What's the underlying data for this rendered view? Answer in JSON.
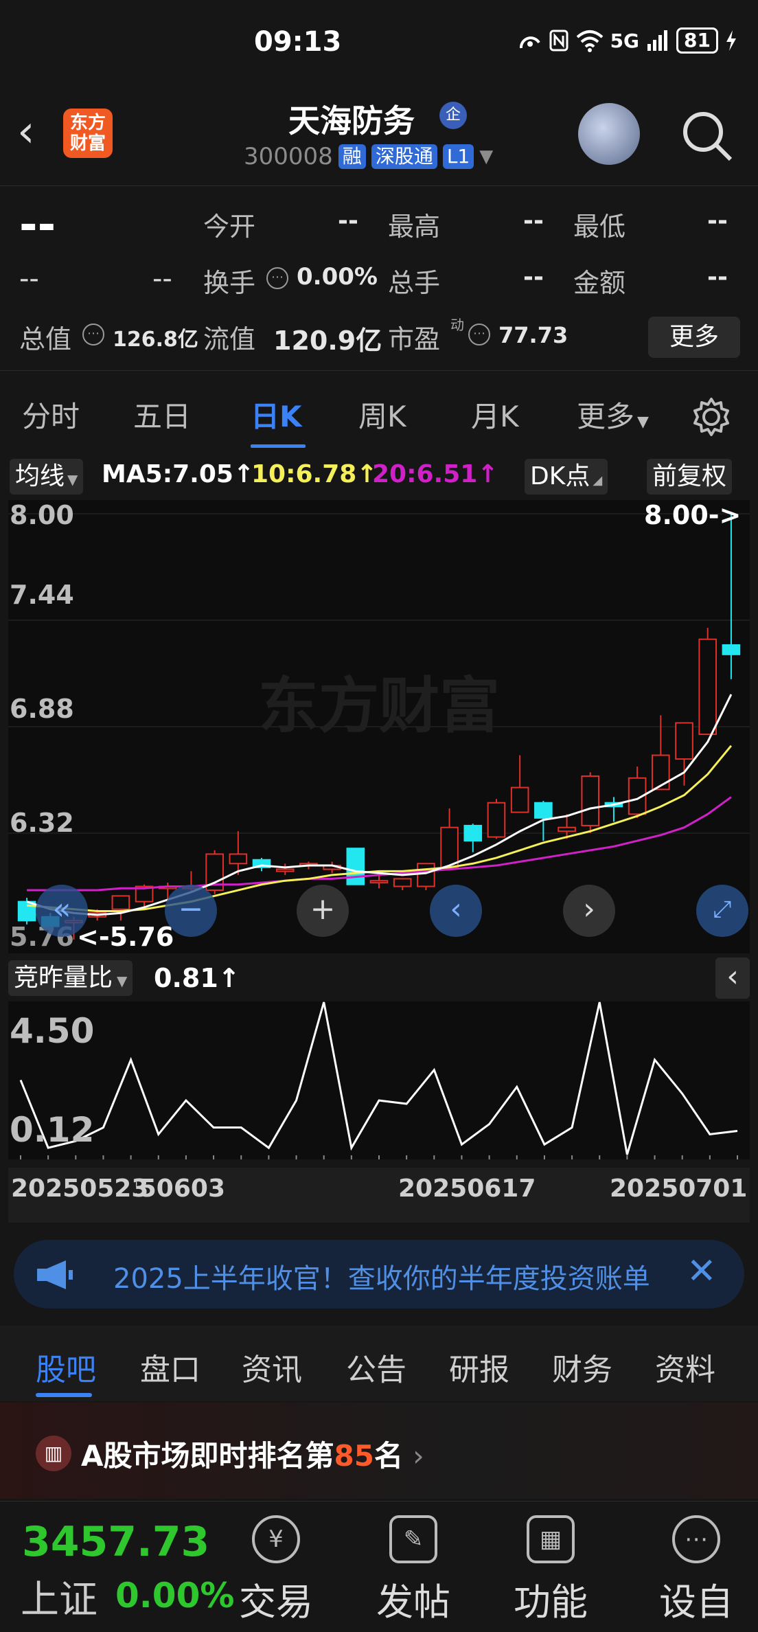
{
  "status": {
    "time": "09:13",
    "network": "5G",
    "battery": "81"
  },
  "header": {
    "logo_text": "东方财富",
    "stock_name": "天海防务",
    "qi_badge": "企",
    "code": "300008",
    "tags": [
      "融",
      "深股通",
      "L1"
    ]
  },
  "quote": {
    "price": "--",
    "change": "--",
    "change_pct": "--",
    "today_open_label": "今开",
    "today_open": "--",
    "high_label": "最高",
    "high": "--",
    "low_label": "最低",
    "low": "--",
    "turnover_label": "换手",
    "turnover": "0.00%",
    "volume_label": "总手",
    "volume": "--",
    "amount_label": "金额",
    "amount": "--",
    "total_value_label": "总值",
    "total_value": "126.8亿",
    "float_value_label": "流值",
    "float_value": "120.9亿",
    "pe_label": "市盈",
    "pe_sup": "动",
    "pe": "77.73",
    "more_label": "更多"
  },
  "ktabs": [
    "分时",
    "五日",
    "日K",
    "周K",
    "月K",
    "更多"
  ],
  "ktab_active": "日K",
  "ma": {
    "select_label": "均线",
    "ma5": "MA5:7.05↑",
    "ma10": "10:6.78↑",
    "ma20": "20:6.51↑",
    "dk_label": "DK点",
    "adjust_label": "前复权",
    "colors": {
      "ma5": "#ffffff",
      "ma10": "#f5f05a",
      "ma20": "#d020c8",
      "up": "#e0302a",
      "down": "#22e6f0"
    }
  },
  "chart_data": {
    "type": "candlestick",
    "y_ticks": [
      "8.00",
      "7.44",
      "6.88",
      "6.32"
    ],
    "ylim": [
      5.76,
      8.0
    ],
    "max_label": "8.00->",
    "min_label": "<-5.76",
    "candles": [
      {
        "o": 5.96,
        "c": 5.86,
        "h": 5.98,
        "l": 5.84
      },
      {
        "o": 5.88,
        "c": 5.83,
        "h": 5.9,
        "l": 5.8
      },
      {
        "o": 5.86,
        "c": 5.86,
        "h": 5.88,
        "l": 5.76
      },
      {
        "o": 5.88,
        "c": 5.9,
        "h": 5.92,
        "l": 5.86
      },
      {
        "o": 5.92,
        "c": 5.99,
        "h": 5.99,
        "l": 5.86
      },
      {
        "o": 5.96,
        "c": 6.04,
        "h": 6.05,
        "l": 5.93
      },
      {
        "o": 6.04,
        "c": 6.04,
        "h": 6.06,
        "l": 5.96
      },
      {
        "o": 6.04,
        "c": 6.04,
        "h": 6.12,
        "l": 6.01
      },
      {
        "o": 6.02,
        "c": 6.21,
        "h": 6.23,
        "l": 6.0
      },
      {
        "o": 6.16,
        "c": 6.21,
        "h": 6.33,
        "l": 6.1
      },
      {
        "o": 6.18,
        "c": 6.14,
        "h": 6.19,
        "l": 6.12
      },
      {
        "o": 6.13,
        "c": 6.13,
        "h": 6.16,
        "l": 6.1
      },
      {
        "o": 6.16,
        "c": 6.16,
        "h": 6.17,
        "l": 6.13
      },
      {
        "o": 6.13,
        "c": 6.15,
        "h": 6.17,
        "l": 6.11
      },
      {
        "o": 6.24,
        "c": 6.05,
        "h": 6.24,
        "l": 6.05
      },
      {
        "o": 6.06,
        "c": 6.07,
        "h": 6.1,
        "l": 6.03
      },
      {
        "o": 6.04,
        "c": 6.08,
        "h": 6.08,
        "l": 6.02
      },
      {
        "o": 6.04,
        "c": 6.16,
        "h": 6.16,
        "l": 6.02
      },
      {
        "o": 6.14,
        "c": 6.35,
        "h": 6.45,
        "l": 6.14
      },
      {
        "o": 6.36,
        "c": 6.28,
        "h": 6.37,
        "l": 6.22
      },
      {
        "o": 6.3,
        "c": 6.48,
        "h": 6.5,
        "l": 6.29
      },
      {
        "o": 6.43,
        "c": 6.56,
        "h": 6.73,
        "l": 6.43
      },
      {
        "o": 6.48,
        "c": 6.4,
        "h": 6.49,
        "l": 6.28
      },
      {
        "o": 6.33,
        "c": 6.35,
        "h": 6.42,
        "l": 6.29
      },
      {
        "o": 6.36,
        "c": 6.62,
        "h": 6.64,
        "l": 6.32
      },
      {
        "o": 6.48,
        "c": 6.46,
        "h": 6.51,
        "l": 6.38
      },
      {
        "o": 6.42,
        "c": 6.61,
        "h": 6.67,
        "l": 6.4
      },
      {
        "o": 6.55,
        "c": 6.73,
        "h": 6.94,
        "l": 6.55
      },
      {
        "o": 6.71,
        "c": 6.9,
        "h": 6.9,
        "l": 6.57
      },
      {
        "o": 6.84,
        "c": 7.34,
        "h": 7.4,
        "l": 6.84
      },
      {
        "o": 7.31,
        "c": 7.26,
        "h": 8.0,
        "l": 7.13
      }
    ],
    "ma5": [
      5.96,
      5.92,
      5.9,
      5.89,
      5.9,
      5.93,
      5.97,
      6.01,
      6.06,
      6.12,
      6.15,
      6.14,
      6.15,
      6.15,
      6.12,
      6.11,
      6.1,
      6.11,
      6.15,
      6.2,
      6.26,
      6.33,
      6.39,
      6.41,
      6.45,
      6.47,
      6.5,
      6.57,
      6.64,
      6.8,
      7.05
    ],
    "ma10": [
      5.94,
      5.93,
      5.92,
      5.91,
      5.91,
      5.92,
      5.94,
      5.96,
      5.99,
      6.02,
      6.05,
      6.07,
      6.08,
      6.1,
      6.11,
      6.12,
      6.12,
      6.13,
      6.14,
      6.16,
      6.19,
      6.23,
      6.27,
      6.3,
      6.33,
      6.37,
      6.41,
      6.46,
      6.52,
      6.63,
      6.78
    ],
    "ma20": [
      6.02,
      6.02,
      6.02,
      6.02,
      6.03,
      6.03,
      6.04,
      6.04,
      6.05,
      6.05,
      6.06,
      6.07,
      6.08,
      6.08,
      6.09,
      6.1,
      6.11,
      6.12,
      6.13,
      6.14,
      6.15,
      6.17,
      6.19,
      6.21,
      6.23,
      6.25,
      6.28,
      6.31,
      6.35,
      6.42,
      6.51
    ]
  },
  "volume": {
    "select_label": "竞昨量比",
    "value": "0.81↑",
    "y_ticks": [
      "4.50",
      "0.12"
    ],
    "ylim": [
      0.12,
      4.5
    ],
    "values": [
      2.3,
      0.3,
      0.5,
      0.9,
      2.9,
      0.7,
      1.7,
      0.9,
      0.9,
      0.3,
      1.7,
      4.6,
      0.3,
      1.7,
      1.6,
      2.6,
      0.4,
      1.0,
      2.1,
      0.4,
      0.9,
      4.6,
      0.1,
      2.9,
      1.9,
      0.7,
      0.8
    ]
  },
  "dates": [
    "20250523",
    "20250603",
    "20250617",
    "20250701"
  ],
  "banner": {
    "text": "2025上半年收官！查收你的半年度投资账单",
    "close": "✕"
  },
  "bottom_tabs": [
    "股吧",
    "盘口",
    "资讯",
    "公告",
    "研报",
    "财务",
    "资料"
  ],
  "bottom_tab_active": "股吧",
  "rank": {
    "prefix": "A股市场即时排名第",
    "number": "85",
    "suffix": "名"
  },
  "nav": {
    "index_value": "3457.73",
    "index_name": "上证",
    "index_change": "0.00%",
    "items": [
      {
        "label": "交易",
        "icon": "¥"
      },
      {
        "label": "发帖",
        "icon": "✎"
      },
      {
        "label": "功能",
        "icon": "▦"
      },
      {
        "label": "设自选",
        "icon": "⋯"
      }
    ]
  }
}
